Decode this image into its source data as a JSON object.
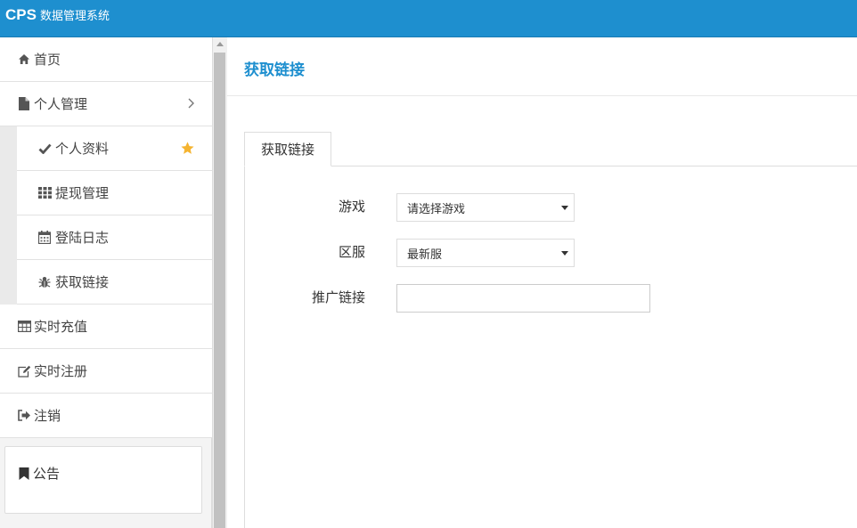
{
  "app": {
    "brand_short": "CPS",
    "brand_name": "数据管理系统"
  },
  "colors": {
    "header_bg": "#1e8fcf",
    "accent": "#1e8fcf",
    "star": "#f5b431"
  },
  "sidebar": {
    "items": [
      {
        "label": "首页",
        "icon": "home-icon"
      },
      {
        "label": "个人管理",
        "icon": "file-icon",
        "expanded": true
      },
      {
        "label": "实时充值",
        "icon": "table-icon"
      },
      {
        "label": "实时注册",
        "icon": "edit-icon"
      },
      {
        "label": "注销",
        "icon": "sign-out-icon"
      }
    ],
    "sub_items": [
      {
        "label": "个人资料",
        "icon": "check-icon",
        "starred": true
      },
      {
        "label": "提现管理",
        "icon": "grid-icon"
      },
      {
        "label": "登陆日志",
        "icon": "calendar-icon"
      },
      {
        "label": "获取链接",
        "icon": "bug-icon"
      }
    ],
    "notice_label": "公告"
  },
  "main": {
    "title": "获取链接",
    "tab_label": "获取链接",
    "form": {
      "game_label": "游戏",
      "game_value": "请选择游戏",
      "server_label": "区服",
      "server_value": "最新服",
      "link_label": "推广链接",
      "link_value": ""
    }
  }
}
